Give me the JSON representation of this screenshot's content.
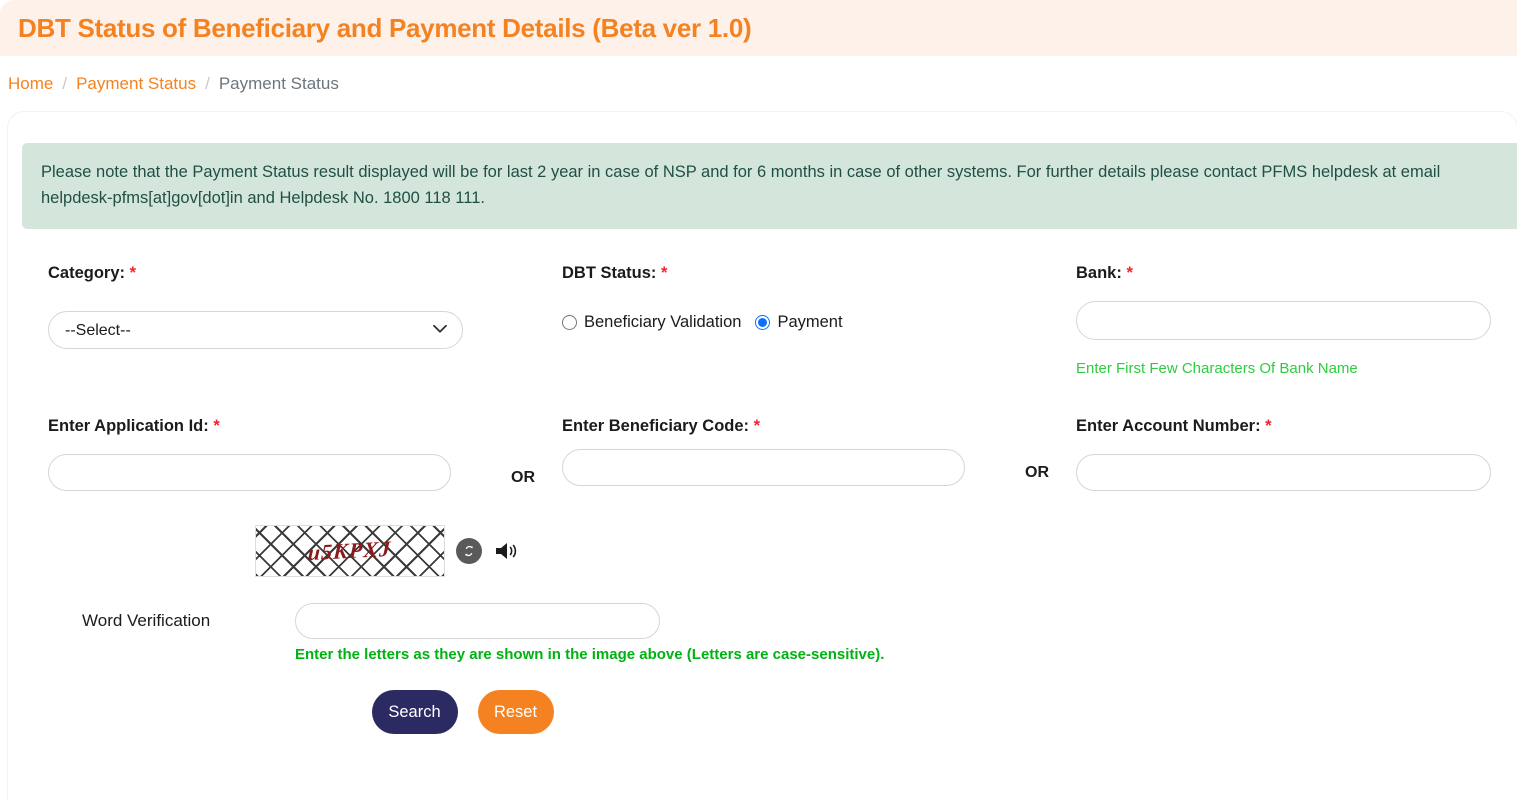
{
  "header": {
    "title": "DBT Status of Beneficiary and Payment Details (Beta ver 1.0)",
    "background": "#fdf1ea",
    "title_color": "#f58220"
  },
  "breadcrumb": {
    "home": "Home",
    "sep1": "/",
    "parent": "Payment Status",
    "sep2": "/",
    "current": "Payment Status"
  },
  "notice": {
    "text": "Please note that the Payment Status result displayed will be for last 2 year in case of NSP and for 6 months in case of other systems. For further details please contact PFMS helpdesk at email helpdesk-pfms[at]gov[dot]in and Helpdesk No. 1800 118 111.",
    "background": "#d4e6dc",
    "color": "#1f4f45"
  },
  "form": {
    "category": {
      "label": "Category:",
      "required": "*",
      "selected": "--Select--",
      "options": [
        "--Select--"
      ],
      "chevron": "chevron-down-icon"
    },
    "dbt_status": {
      "label": "DBT Status:",
      "required": "*",
      "options": [
        {
          "label": "Beneficiary Validation",
          "checked": false
        },
        {
          "label": "Payment",
          "checked": true
        }
      ],
      "accent": "#0d6efd"
    },
    "bank": {
      "label": "Bank:",
      "required": "*",
      "value": "",
      "placeholder": "",
      "hint": "Enter First Few Characters Of Bank Name",
      "hint_color": "#2ecc40"
    },
    "application_id": {
      "label": "Enter Application Id:",
      "required": "*",
      "value": "",
      "placeholder": ""
    },
    "or_1": "OR",
    "beneficiary_code": {
      "label": "Enter Beneficiary Code:",
      "required": "*",
      "value": "",
      "placeholder": ""
    },
    "or_2": "OR",
    "account_number": {
      "label": "Enter Account Number:",
      "required": "*",
      "value": "",
      "placeholder": ""
    }
  },
  "captcha": {
    "text": "u5KPXJ",
    "text_color": "#8d1a1a",
    "refresh_icon": "refresh-icon",
    "audio_icon": "speaker-icon"
  },
  "word_verification": {
    "label": "Word Verification",
    "value": "",
    "placeholder": "",
    "hint": "Enter the letters as they are shown in the image above (Letters are case-sensitive).",
    "hint_color": "#00b312"
  },
  "actions": {
    "search_label": "Search",
    "search_color": "#2b2a63",
    "reset_label": "Reset",
    "reset_color": "#f58220"
  }
}
